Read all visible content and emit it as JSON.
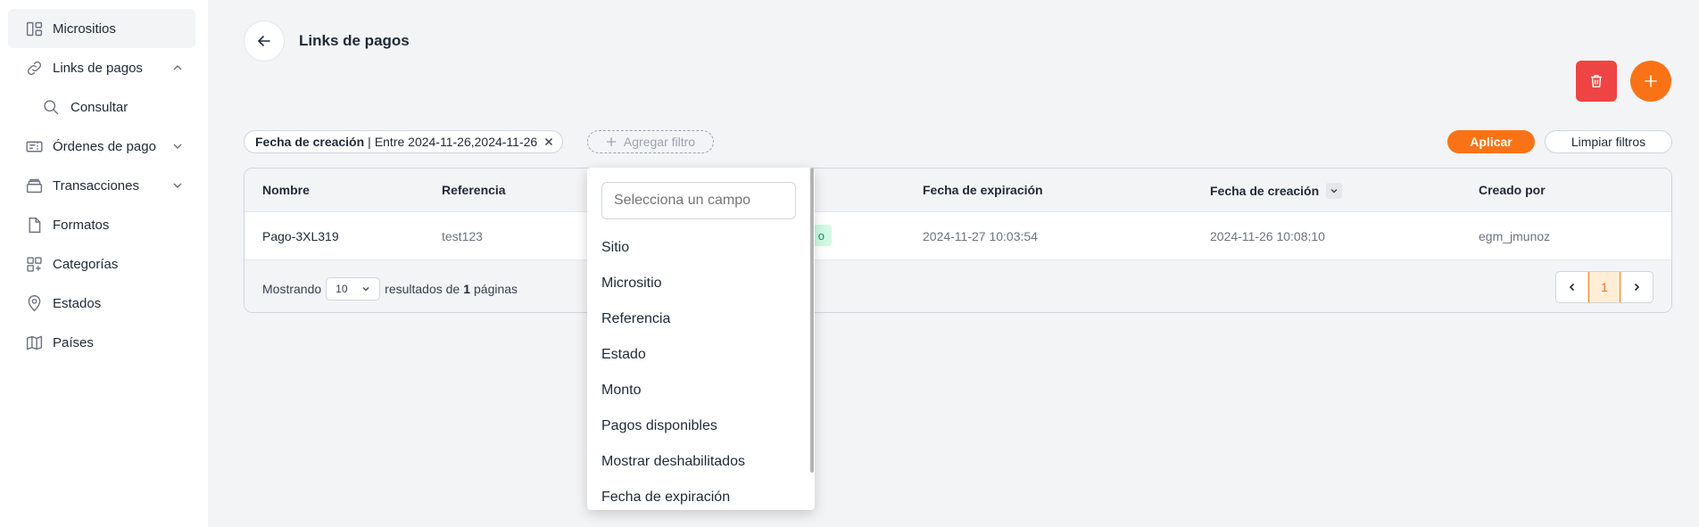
{
  "sidebar": {
    "items": [
      {
        "label": "Micrositios",
        "icon": "layout-icon"
      },
      {
        "label": "Links de pagos",
        "icon": "link-icon",
        "expanded": true
      },
      {
        "label": "Consultar",
        "icon": "search-icon"
      },
      {
        "label": "Órdenes de pago",
        "icon": "ticket-icon",
        "expanded": false
      },
      {
        "label": "Transacciones",
        "icon": "stack-icon",
        "expanded": false
      },
      {
        "label": "Formatos",
        "icon": "file-icon"
      },
      {
        "label": "Categorías",
        "icon": "grid-plus-icon"
      },
      {
        "label": "Estados",
        "icon": "location-pin-icon"
      },
      {
        "label": "Países",
        "icon": "map-icon"
      }
    ]
  },
  "header": {
    "title": "Links de pagos"
  },
  "filters": {
    "chip_field": "Fecha de creación",
    "chip_separator": "|",
    "chip_value": "Entre 2024-11-26,2024-11-26",
    "add_filter_label": "Agregar filtro",
    "apply_label": "Aplicar",
    "clear_label": "Limpiar filtros"
  },
  "table": {
    "columns": [
      "Nombre",
      "Referencia",
      "Fecha de expiración",
      "Fecha de creación",
      "Creado por"
    ],
    "rows": [
      {
        "nombre": "Pago-3XL319",
        "referencia": "test123",
        "estado_fragment": "o",
        "expiracion": "2024-11-27 10:03:54",
        "creacion": "2024-11-26 10:08:10",
        "creado_por": "egm_jmunoz"
      }
    ],
    "footer": {
      "showing_label": "Mostrando",
      "per_page": "10",
      "results_label": "resultados de",
      "pages_count": "1",
      "pages_label": "páginas",
      "current_page": "1"
    }
  },
  "dropdown": {
    "placeholder": "Selecciona un campo",
    "options": [
      "Sitio",
      "Micrositio",
      "Referencia",
      "Estado",
      "Monto",
      "Pagos disponibles",
      "Mostrar deshabilitados",
      "Fecha de expiración"
    ]
  },
  "colors": {
    "accent": "#f97316",
    "danger": "#ef4444",
    "success_bg": "#d1fae5"
  }
}
